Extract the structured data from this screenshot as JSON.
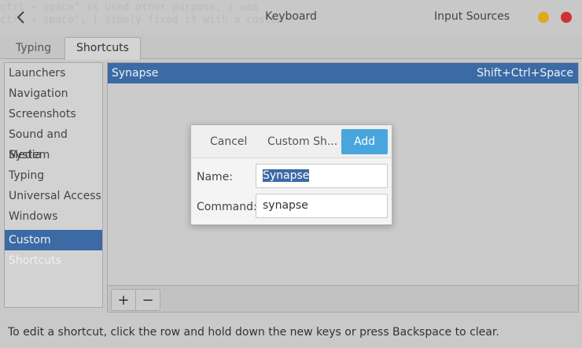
{
  "titlebar": {
    "background_text": [
      "ctrl + space\" is used other purpose, i was",
      "ctrl + space\", i simply fixed it with a custom"
    ],
    "title": "Keyboard",
    "input_sources_label": "Input Sources"
  },
  "tabs": [
    {
      "label": "Typing",
      "active": false
    },
    {
      "label": "Shortcuts",
      "active": true
    }
  ],
  "sidebar": {
    "items": [
      {
        "label": "Launchers"
      },
      {
        "label": "Navigation"
      },
      {
        "label": "Screenshots"
      },
      {
        "label": "Sound and Media"
      },
      {
        "label": "System"
      },
      {
        "label": "Typing"
      },
      {
        "label": "Universal Access"
      },
      {
        "label": "Windows"
      },
      {
        "label": "Custom Shortcuts"
      }
    ],
    "active_index": 8
  },
  "shortcuts": {
    "rows": [
      {
        "name": "Synapse",
        "keys": "Shift+Ctrl+Space"
      }
    ],
    "add_symbol": "+",
    "remove_symbol": "−"
  },
  "hint": "To edit a shortcut, click the row and hold down the new keys or press Backspace to clear.",
  "dialog": {
    "cancel_label": "Cancel",
    "title": "Custom Sh...",
    "add_label": "Add",
    "name_label": "Name:",
    "name_value": "Synapse",
    "command_label": "Command:",
    "command_value": "synapse"
  },
  "colors": {
    "accent": "#3b6aa5",
    "add_button": "#48a6dc",
    "minimize": "#e0a81c",
    "close": "#d03030"
  }
}
